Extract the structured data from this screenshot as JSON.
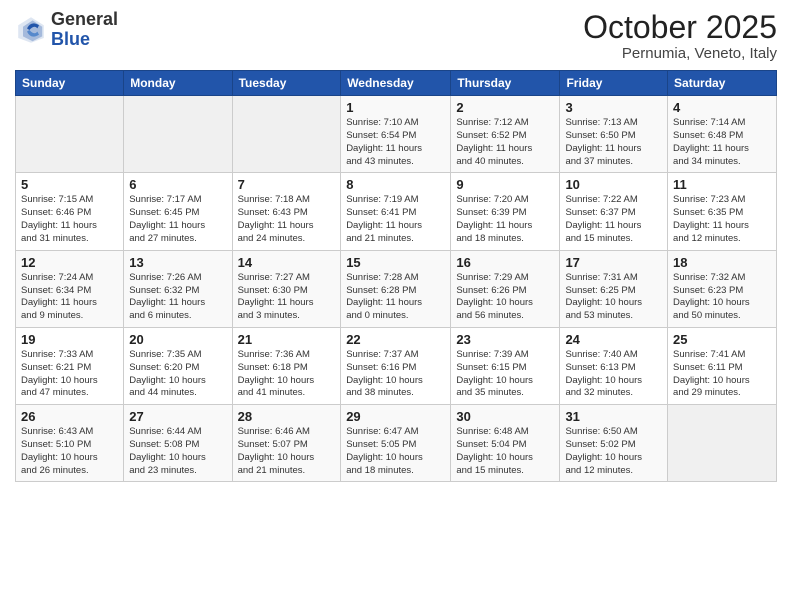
{
  "logo": {
    "general": "General",
    "blue": "Blue"
  },
  "header": {
    "month": "October 2025",
    "location": "Pernumia, Veneto, Italy"
  },
  "weekdays": [
    "Sunday",
    "Monday",
    "Tuesday",
    "Wednesday",
    "Thursday",
    "Friday",
    "Saturday"
  ],
  "weeks": [
    [
      {
        "day": "",
        "info": ""
      },
      {
        "day": "",
        "info": ""
      },
      {
        "day": "",
        "info": ""
      },
      {
        "day": "1",
        "info": "Sunrise: 7:10 AM\nSunset: 6:54 PM\nDaylight: 11 hours\nand 43 minutes."
      },
      {
        "day": "2",
        "info": "Sunrise: 7:12 AM\nSunset: 6:52 PM\nDaylight: 11 hours\nand 40 minutes."
      },
      {
        "day": "3",
        "info": "Sunrise: 7:13 AM\nSunset: 6:50 PM\nDaylight: 11 hours\nand 37 minutes."
      },
      {
        "day": "4",
        "info": "Sunrise: 7:14 AM\nSunset: 6:48 PM\nDaylight: 11 hours\nand 34 minutes."
      }
    ],
    [
      {
        "day": "5",
        "info": "Sunrise: 7:15 AM\nSunset: 6:46 PM\nDaylight: 11 hours\nand 31 minutes."
      },
      {
        "day": "6",
        "info": "Sunrise: 7:17 AM\nSunset: 6:45 PM\nDaylight: 11 hours\nand 27 minutes."
      },
      {
        "day": "7",
        "info": "Sunrise: 7:18 AM\nSunset: 6:43 PM\nDaylight: 11 hours\nand 24 minutes."
      },
      {
        "day": "8",
        "info": "Sunrise: 7:19 AM\nSunset: 6:41 PM\nDaylight: 11 hours\nand 21 minutes."
      },
      {
        "day": "9",
        "info": "Sunrise: 7:20 AM\nSunset: 6:39 PM\nDaylight: 11 hours\nand 18 minutes."
      },
      {
        "day": "10",
        "info": "Sunrise: 7:22 AM\nSunset: 6:37 PM\nDaylight: 11 hours\nand 15 minutes."
      },
      {
        "day": "11",
        "info": "Sunrise: 7:23 AM\nSunset: 6:35 PM\nDaylight: 11 hours\nand 12 minutes."
      }
    ],
    [
      {
        "day": "12",
        "info": "Sunrise: 7:24 AM\nSunset: 6:34 PM\nDaylight: 11 hours\nand 9 minutes."
      },
      {
        "day": "13",
        "info": "Sunrise: 7:26 AM\nSunset: 6:32 PM\nDaylight: 11 hours\nand 6 minutes."
      },
      {
        "day": "14",
        "info": "Sunrise: 7:27 AM\nSunset: 6:30 PM\nDaylight: 11 hours\nand 3 minutes."
      },
      {
        "day": "15",
        "info": "Sunrise: 7:28 AM\nSunset: 6:28 PM\nDaylight: 11 hours\nand 0 minutes."
      },
      {
        "day": "16",
        "info": "Sunrise: 7:29 AM\nSunset: 6:26 PM\nDaylight: 10 hours\nand 56 minutes."
      },
      {
        "day": "17",
        "info": "Sunrise: 7:31 AM\nSunset: 6:25 PM\nDaylight: 10 hours\nand 53 minutes."
      },
      {
        "day": "18",
        "info": "Sunrise: 7:32 AM\nSunset: 6:23 PM\nDaylight: 10 hours\nand 50 minutes."
      }
    ],
    [
      {
        "day": "19",
        "info": "Sunrise: 7:33 AM\nSunset: 6:21 PM\nDaylight: 10 hours\nand 47 minutes."
      },
      {
        "day": "20",
        "info": "Sunrise: 7:35 AM\nSunset: 6:20 PM\nDaylight: 10 hours\nand 44 minutes."
      },
      {
        "day": "21",
        "info": "Sunrise: 7:36 AM\nSunset: 6:18 PM\nDaylight: 10 hours\nand 41 minutes."
      },
      {
        "day": "22",
        "info": "Sunrise: 7:37 AM\nSunset: 6:16 PM\nDaylight: 10 hours\nand 38 minutes."
      },
      {
        "day": "23",
        "info": "Sunrise: 7:39 AM\nSunset: 6:15 PM\nDaylight: 10 hours\nand 35 minutes."
      },
      {
        "day": "24",
        "info": "Sunrise: 7:40 AM\nSunset: 6:13 PM\nDaylight: 10 hours\nand 32 minutes."
      },
      {
        "day": "25",
        "info": "Sunrise: 7:41 AM\nSunset: 6:11 PM\nDaylight: 10 hours\nand 29 minutes."
      }
    ],
    [
      {
        "day": "26",
        "info": "Sunrise: 6:43 AM\nSunset: 5:10 PM\nDaylight: 10 hours\nand 26 minutes."
      },
      {
        "day": "27",
        "info": "Sunrise: 6:44 AM\nSunset: 5:08 PM\nDaylight: 10 hours\nand 23 minutes."
      },
      {
        "day": "28",
        "info": "Sunrise: 6:46 AM\nSunset: 5:07 PM\nDaylight: 10 hours\nand 21 minutes."
      },
      {
        "day": "29",
        "info": "Sunrise: 6:47 AM\nSunset: 5:05 PM\nDaylight: 10 hours\nand 18 minutes."
      },
      {
        "day": "30",
        "info": "Sunrise: 6:48 AM\nSunset: 5:04 PM\nDaylight: 10 hours\nand 15 minutes."
      },
      {
        "day": "31",
        "info": "Sunrise: 6:50 AM\nSunset: 5:02 PM\nDaylight: 10 hours\nand 12 minutes."
      },
      {
        "day": "",
        "info": ""
      }
    ]
  ]
}
